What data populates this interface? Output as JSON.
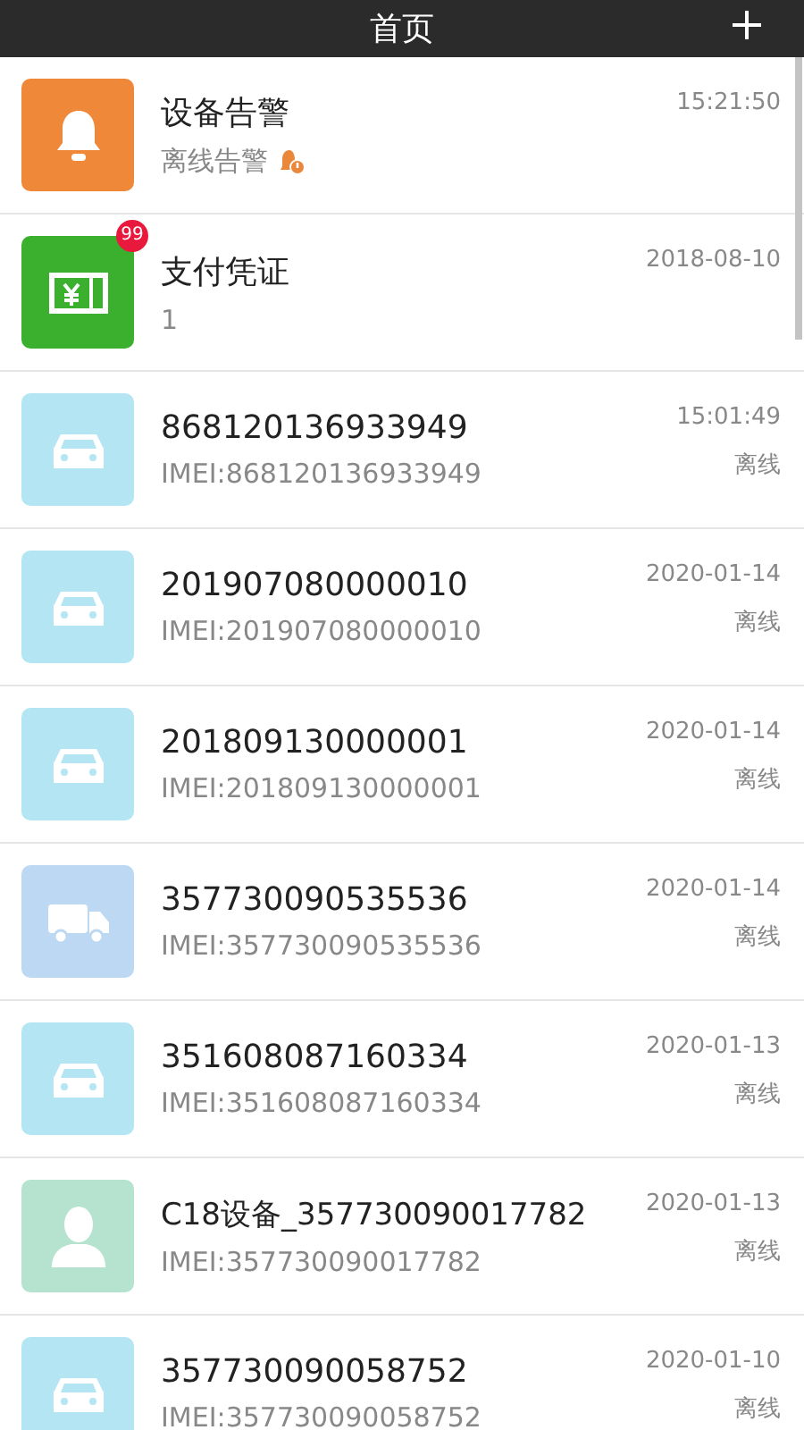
{
  "header": {
    "title": "首页"
  },
  "items": [
    {
      "kind": "alarm",
      "title": "设备告警",
      "subtitle": "离线告警",
      "time": "15:21:50"
    },
    {
      "kind": "voucher",
      "title": "支付凭证",
      "subtitle": "1",
      "time": "2018-08-10",
      "badge": "99"
    },
    {
      "kind": "car",
      "title": "868120136933949",
      "subtitle": "IMEI:868120136933949",
      "time": "15:01:49",
      "status": "离线"
    },
    {
      "kind": "car",
      "title": "201907080000010",
      "subtitle": "IMEI:201907080000010",
      "time": "2020-01-14",
      "status": "离线"
    },
    {
      "kind": "car",
      "title": "201809130000001",
      "subtitle": "IMEI:201809130000001",
      "time": "2020-01-14",
      "status": "离线"
    },
    {
      "kind": "truck",
      "title": "357730090535536",
      "subtitle": "IMEI:357730090535536",
      "time": "2020-01-14",
      "status": "离线"
    },
    {
      "kind": "car",
      "title": "351608087160334",
      "subtitle": "IMEI:351608087160334",
      "time": "2020-01-13",
      "status": "离线"
    },
    {
      "kind": "person",
      "title": "C18设备_357730090017782",
      "subtitle": "IMEI:357730090017782",
      "time": "2020-01-13",
      "status": "离线"
    },
    {
      "kind": "car",
      "title": "357730090058752",
      "subtitle": "IMEI:357730090058752",
      "time": "2020-01-10",
      "status": "离线"
    }
  ]
}
